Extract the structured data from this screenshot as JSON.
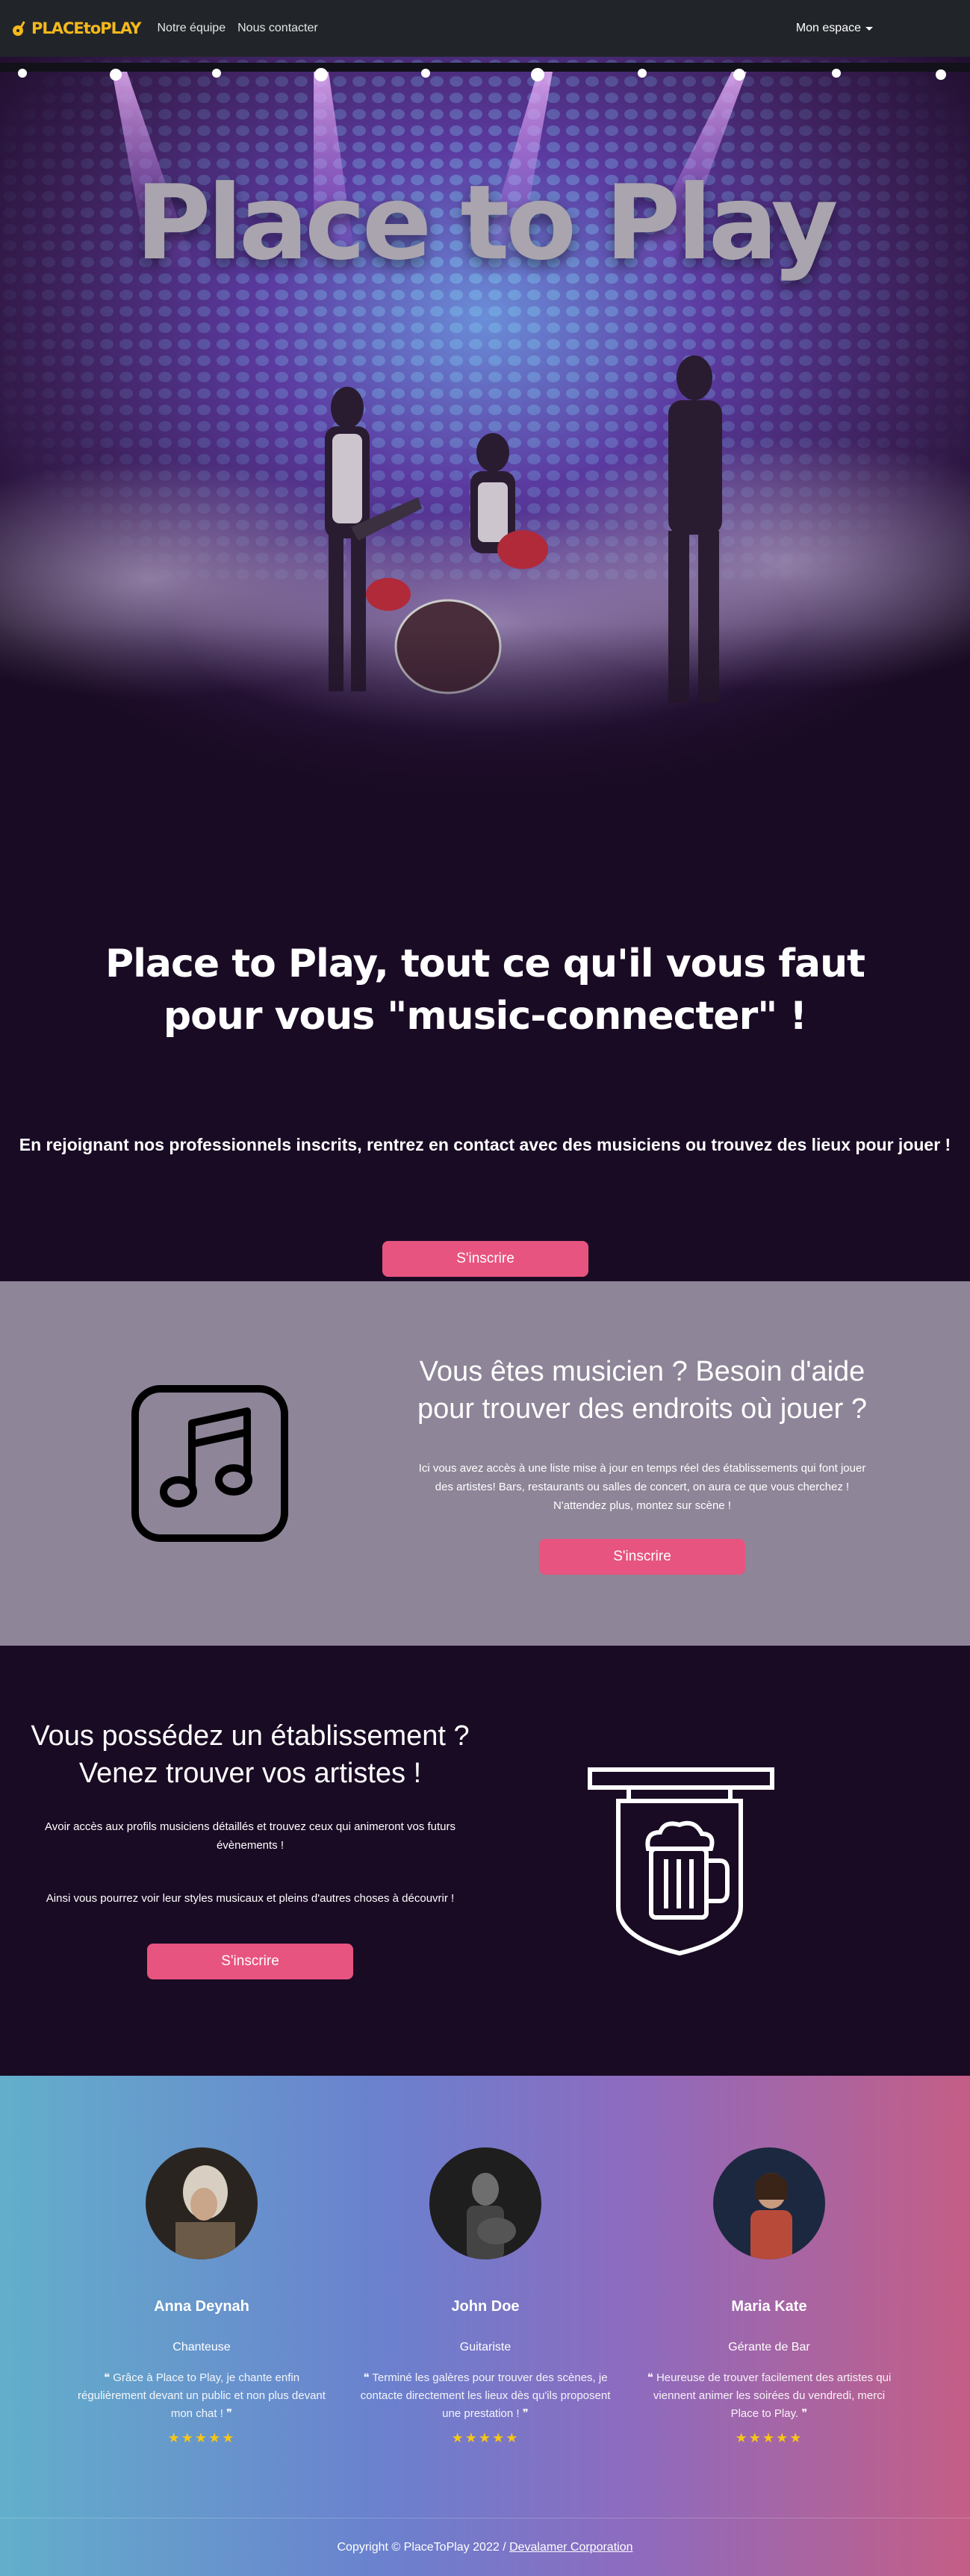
{
  "nav": {
    "logo_main": "PLACEtoPLAY",
    "links": [
      "Notre équipe",
      "Nous contacter"
    ],
    "account_label": "Mon espace"
  },
  "hero": {
    "title": "Place to Play",
    "headline": "Place to Play, tout ce qu'il vous faut pour vous \"music-connecter\" !",
    "subtitle": "En rejoignant nos professionnels inscrits, rentrez en contact avec des musiciens ou trouvez des lieux pour jouer !",
    "cta": "S'inscrire"
  },
  "musician": {
    "title": "Vous êtes musicien ? Besoin d'aide pour trouver des endroits où jouer ?",
    "text": "Ici vous avez accès à une liste mise à jour en temps réel des établissements qui font jouer des artistes! Bars, restaurants ou salles de concert, on aura ce que vous cherchez ! N'attendez plus, montez sur scène !",
    "cta": "S'inscrire",
    "icon": "music-note-icon"
  },
  "venue": {
    "title": "Vous possédez un établissement ? Venez trouver vos artistes !",
    "text1": "Avoir accès aux profils musiciens détaillés et trouvez ceux qui animeront vos futurs évènements !",
    "text2": "Ainsi vous pourrez voir leur styles musicaux et pleins d'autres choses à découvrir !",
    "cta": "S'inscrire",
    "icon": "beer-sign-icon"
  },
  "testimonials": [
    {
      "name": "Anna Deynah",
      "role": "Chanteuse",
      "quote": "Grâce à Place to Play, je chante enfin régulièrement devant un public et non plus devant mon chat !",
      "stars": "★★★★★"
    },
    {
      "name": "John Doe",
      "role": "Guitariste",
      "quote": "Terminé les galères pour trouver des scènes, je contacte directement les lieux dès qu'ils proposent une prestation !",
      "stars": "★★★★★"
    },
    {
      "name": "Maria Kate",
      "role": "Gérante de Bar",
      "quote": "Heureuse de trouver facilement des artistes qui viennent animer les soirées du vendredi, merci Place to Play.",
      "stars": "★★★★★"
    }
  ],
  "footer": {
    "copyright": "Copyright © PlaceToPlay 2022 / ",
    "link": "Devalamer Corporation"
  },
  "colors": {
    "primary_button": "#e75480",
    "navbar": "#212529",
    "dark_bg": "#1a0b24",
    "musician_bg": "#8e8598",
    "stars": "#f5c518"
  }
}
